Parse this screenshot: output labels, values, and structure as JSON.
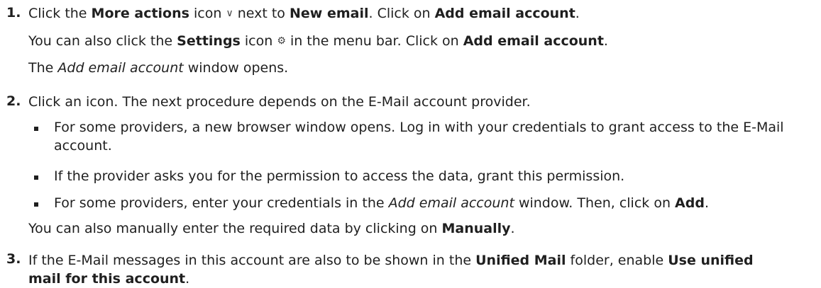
{
  "steps": [
    {
      "number": "1.",
      "lines": [
        {
          "t1": "Click the ",
          "b1": "More actions",
          "t2": " icon ",
          "icon": "∨",
          "icon_name": "chevron-down-icon",
          "t3": " next to ",
          "b2": "New email",
          "t4": ". Click on ",
          "b3": "Add email account",
          "t5": "."
        },
        {
          "t1": "You can also click the ",
          "b1": "Settings",
          "t2": " icon ",
          "icon": "⚙",
          "icon_name": "gear-icon",
          "t3": " in the menu bar. Click on ",
          "b2": "Add email account",
          "t4": "."
        },
        {
          "t1": "The ",
          "i1": "Add email account",
          "t2": " window opens."
        }
      ]
    },
    {
      "number": "2.",
      "intro": "Click an icon. The next procedure depends on the E-Mail account provider.",
      "bullets": [
        {
          "text": "For some providers, a new browser window opens. Log in with your credentials to grant access to the E-Mail account."
        },
        {
          "text": "If the provider asks you for the permission to access the data, grant this permission."
        },
        {
          "t1": "For some providers, enter your credentials in the ",
          "i1": "Add email account",
          "t2": " window. Then, click on ",
          "b1": "Add",
          "t3": "."
        }
      ],
      "outro": {
        "t1": "You can also manually enter the required data by clicking on ",
        "b1": "Manually",
        "t2": "."
      }
    },
    {
      "number": "3.",
      "t1": "If the E-Mail messages in this account are also to be shown in the ",
      "b1": "Unified Mail",
      "t2": " folder, enable ",
      "b2": "Use unified mail for this account",
      "t3": "."
    }
  ]
}
